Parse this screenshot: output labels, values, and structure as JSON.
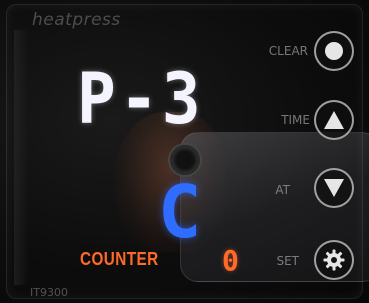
{
  "brand": "heatpress",
  "model": "IT9300",
  "display": {
    "main": "P-3",
    "secondary": "C",
    "counter_label": "COUNTER",
    "counter_value": "0"
  },
  "buttons": [
    {
      "id": "clear",
      "label": "CLEAR",
      "icon": "circle-icon"
    },
    {
      "id": "time",
      "label": "TIME",
      "icon": "triangle-up-icon"
    },
    {
      "id": "at",
      "label": "AT",
      "icon": "triangle-down-icon"
    },
    {
      "id": "set",
      "label": "SET",
      "icon": "gear-icon"
    }
  ],
  "colors": {
    "main_digits": "#f4f4ff",
    "secondary_digit": "#2f6dff",
    "counter": "#ff6a2a"
  }
}
